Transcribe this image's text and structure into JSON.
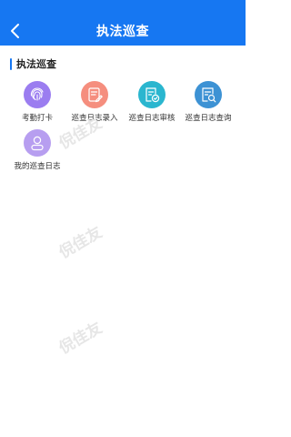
{
  "header": {
    "title": "执法巡查"
  },
  "section": {
    "title": "执法巡查"
  },
  "menu": [
    {
      "label": "考勤打卡",
      "icon": "fingerprint-icon",
      "color": "#9b7df0"
    },
    {
      "label": "巡查日志录入",
      "icon": "note-edit-icon",
      "color": "#f58e7e"
    },
    {
      "label": "巡查日志审核",
      "icon": "doc-check-icon",
      "color": "#2ab6cf"
    },
    {
      "label": "巡查日志查询",
      "icon": "doc-search-icon",
      "color": "#3d92d4"
    },
    {
      "label": "我的巡查日志",
      "icon": "user-icon",
      "color": "#b79ef0"
    }
  ],
  "watermark": "倪佳友",
  "colors": {
    "header": "#1677f2",
    "accent": "#1677f2"
  }
}
